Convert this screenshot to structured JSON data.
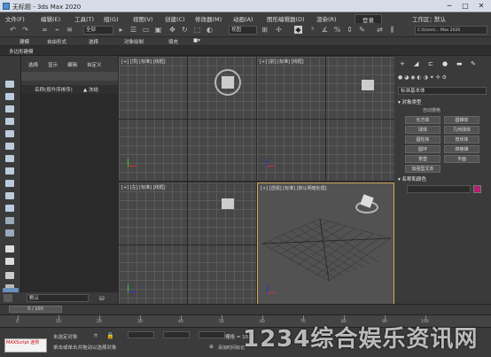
{
  "titlebar": {
    "title": "无标题 - 3ds Max 2020",
    "min": "─",
    "max": "□",
    "close": "✕"
  },
  "menu": [
    "文件(F)",
    "编辑(E)",
    "工具(T)",
    "组(G)",
    "视图(V)",
    "创建(C)",
    "修改器(M)",
    "动画(A)",
    "图形编辑器(D)",
    "渲染(R)",
    "登录",
    "工作区：",
    "默认"
  ],
  "toolbar": {
    "selection_filter": "全部",
    "ref_coord": "视图",
    "workspace_path": "C:\\Users\\... Max 2020",
    "create_set": "创建选择集"
  },
  "ribbon": {
    "tabs": [
      "建模",
      "自由形式",
      "选择",
      "对象绘制",
      "填充"
    ],
    "subpanel": "多边形建模"
  },
  "explorer": {
    "menu": [
      "选择",
      "显示",
      "编辑",
      "自定义"
    ],
    "col_name": "名称(按升序排序)",
    "col_frozen": "▲ 冻结"
  },
  "layer": {
    "name": "默认"
  },
  "viewports": {
    "top": "[+] [顶] [标准] [线框]",
    "front": "[+] [前] [标准] [线框]",
    "left": "[+] [左] [标准] [线框]",
    "persp": "[+] [透视] [标准] [默认明暗处理]"
  },
  "cmd": {
    "dropdown": "标准基本体",
    "rollout_type": "对象类型",
    "autogrid": "自动栅格",
    "buttons": [
      "长方体",
      "圆锥体",
      "球体",
      "几何球体",
      "圆柱体",
      "管状体",
      "圆环",
      "四棱锥",
      "茶壶",
      "平面",
      "加强型文本"
    ],
    "rollout_name": "名称和颜色"
  },
  "time": {
    "slider": "0 / 100",
    "ticks": [
      "0",
      "10",
      "20",
      "30",
      "40",
      "50",
      "60",
      "70",
      "80",
      "90",
      "100"
    ]
  },
  "status": {
    "maxscript": "MAXScript 迷你",
    "selected": "未选定对象",
    "hint": "单击或单击并拖动以选择对象",
    "addtime": "添加时间标记",
    "grid": "栅格 = 10.0"
  },
  "watermark": "1234综合娱乐资讯网",
  "colors": {
    "accent_border": "#d3a95a",
    "object_color": "#b0206d"
  }
}
